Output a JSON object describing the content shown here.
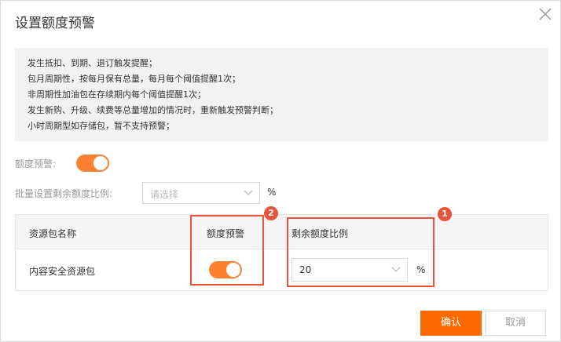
{
  "dialog": {
    "title": "设置额度预警",
    "close_icon": "close-icon"
  },
  "notice": {
    "lines": [
      "发生抵扣、到期、退订触发提醒；",
      "包月周期性，按每月保有总量，每月每个阈值提醒1次；",
      "非周期性加油包在存续期内每个阈值提醒1次；",
      "发生新购、升级、续费等总量增加的情况时，重新触发预警判断；",
      "小时周期型如存储包，暂不支持预警；"
    ]
  },
  "form": {
    "alert_label": "额度预警:",
    "alert_enabled": true,
    "batch_label": "批量设置剩余额度比例:",
    "batch_placeholder": "请选择",
    "percent_unit": "%"
  },
  "table": {
    "columns": [
      "资源包名称",
      "额度预警",
      "剩余额度比例"
    ],
    "rows": [
      {
        "name": "内容安全资源包",
        "alert_enabled": true,
        "ratio": "20",
        "unit": "%"
      }
    ]
  },
  "annotations": [
    {
      "number": "1",
      "color": "#e8533c"
    },
    {
      "number": "2",
      "color": "#e8533c"
    }
  ],
  "footer": {
    "confirm_label": "确认",
    "cancel_label": "取消"
  },
  "colors": {
    "accent": "#ff6a00",
    "toggle_on": "#ff8030",
    "highlight": "#e8533c"
  }
}
